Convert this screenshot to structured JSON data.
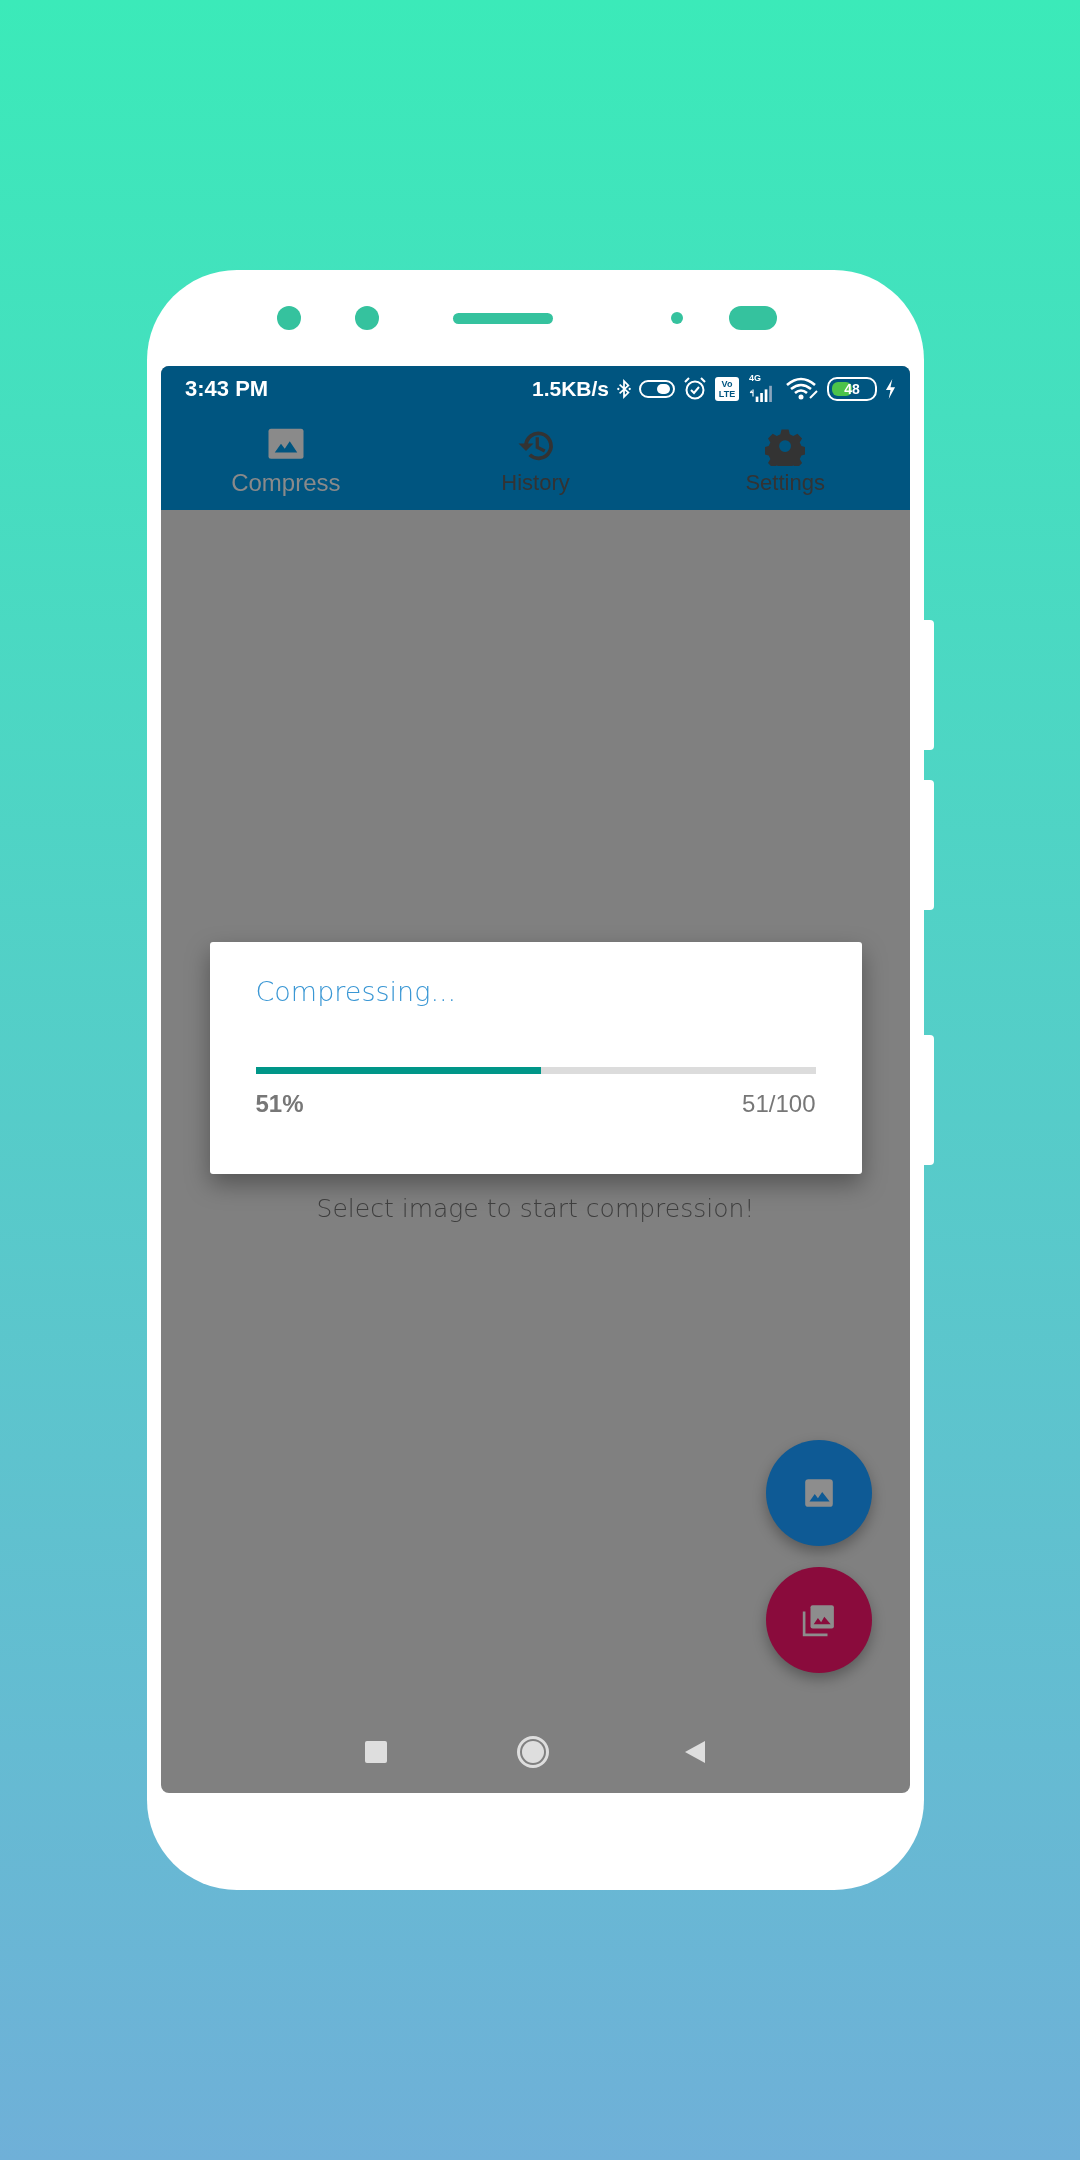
{
  "status_bar": {
    "time": "3:43 PM",
    "net_speed": "1.5KB/s",
    "volte": [
      "Vo",
      "LTE"
    ],
    "network_type": "4G",
    "battery": "48"
  },
  "tabs": [
    {
      "label": "Compress",
      "kind": "image",
      "selected": true
    },
    {
      "label": "History",
      "kind": "history",
      "selected": false
    },
    {
      "label": "Settings",
      "kind": "gear",
      "selected": false
    }
  ],
  "dialog": {
    "title": "Compressing...",
    "level": 0.51,
    "percent": "51%",
    "count": "51/100"
  },
  "message": "Select image to start compression!",
  "fabs": [
    {
      "kind": "image",
      "color": "#0e5a95"
    },
    {
      "kind": "gallery",
      "color": "#8a0b3c"
    }
  ]
}
